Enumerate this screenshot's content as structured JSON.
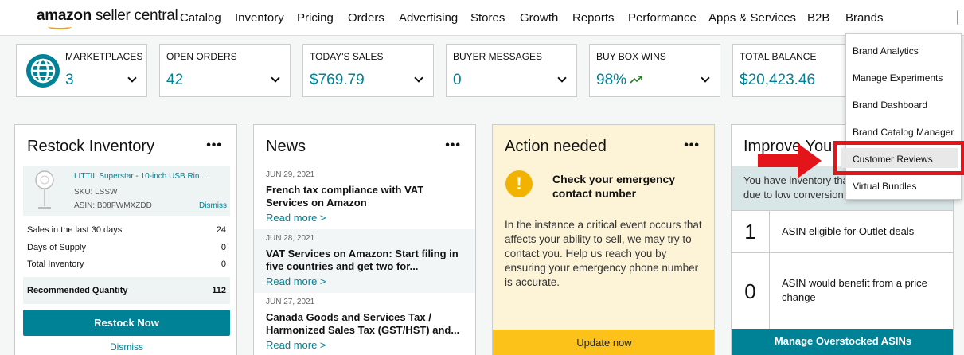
{
  "nav": {
    "logo_bold": "amazon",
    "logo_rest": " seller central",
    "items": [
      "Catalog",
      "Inventory",
      "Pricing",
      "Orders",
      "Advertising",
      "Stores",
      "Growth",
      "Reports",
      "Performance",
      "Apps & Services",
      "B2B",
      "Brands"
    ]
  },
  "metrics": [
    {
      "label": "MARKETPLACES",
      "value": "3",
      "icon": "globe-icon"
    },
    {
      "label": "OPEN ORDERS",
      "value": "42"
    },
    {
      "label": "TODAY'S SALES",
      "value": "$769.79"
    },
    {
      "label": "BUYER MESSAGES",
      "value": "0"
    },
    {
      "label": "BUY BOX WINS",
      "value": "98%",
      "icon": "trend-up-icon"
    },
    {
      "label": "TOTAL BALANCE",
      "value": "$20,423.46"
    }
  ],
  "restock": {
    "title": "Restock Inventory",
    "menu": "•••",
    "product_name": "LITTIL Superstar - 10-inch USB Rin...",
    "sku": "SKU: LSSW",
    "asin": "ASIN: B08FWMXZDD",
    "dismiss_small": "Dismiss",
    "rows": [
      {
        "label": "Sales in the last 30 days",
        "value": "24"
      },
      {
        "label": "Days of Supply",
        "value": "0"
      },
      {
        "label": "Total Inventory",
        "value": "0"
      }
    ],
    "recommended_label": "Recommended Quantity",
    "recommended_value": "112",
    "button": "Restock Now",
    "dismiss": "Dismiss"
  },
  "news": {
    "title": "News",
    "menu": "•••",
    "items": [
      {
        "date": "JUN 29, 2021",
        "headline": "French tax compliance with VAT Services on Amazon",
        "more": "Read more >"
      },
      {
        "date": "JUN 28, 2021",
        "headline": "VAT Services on Amazon: Start filing in five countries and get two for...",
        "more": "Read more >"
      },
      {
        "date": "JUN 27, 2021",
        "headline": "Canada Goods and Services Tax / Harmonized Sales Tax (GST/HST) and...",
        "more": "Read more >"
      }
    ]
  },
  "action": {
    "title": "Action needed",
    "menu": "•••",
    "alert_symbol": "!",
    "headline": "Check your emergency contact number",
    "body": "In the instance a critical event occurs that affects your ability to sell, we may try to contact you. Help us reach you by ensuring your emergency phone number is accurate.",
    "button": "Update now"
  },
  "improve": {
    "title": "Improve You",
    "banner_line1": "You have inventory tha",
    "banner_line2": "due to low conversion",
    "rows": [
      {
        "num": "1",
        "text": "ASIN eligible for Outlet deals"
      },
      {
        "num": "0",
        "text": "ASIN would benefit from a price change"
      }
    ],
    "button": "Manage Overstocked ASINs"
  },
  "brands_menu": {
    "items": [
      "Brand Analytics",
      "Manage Experiments",
      "Brand Dashboard",
      "Brand Catalog Manager",
      "Customer Reviews",
      "Virtual Bundles"
    ],
    "highlighted": "Customer Reviews"
  },
  "colors": {
    "teal": "#008296",
    "accent_red": "#e3151a",
    "update_yellow": "#fcc21a"
  }
}
